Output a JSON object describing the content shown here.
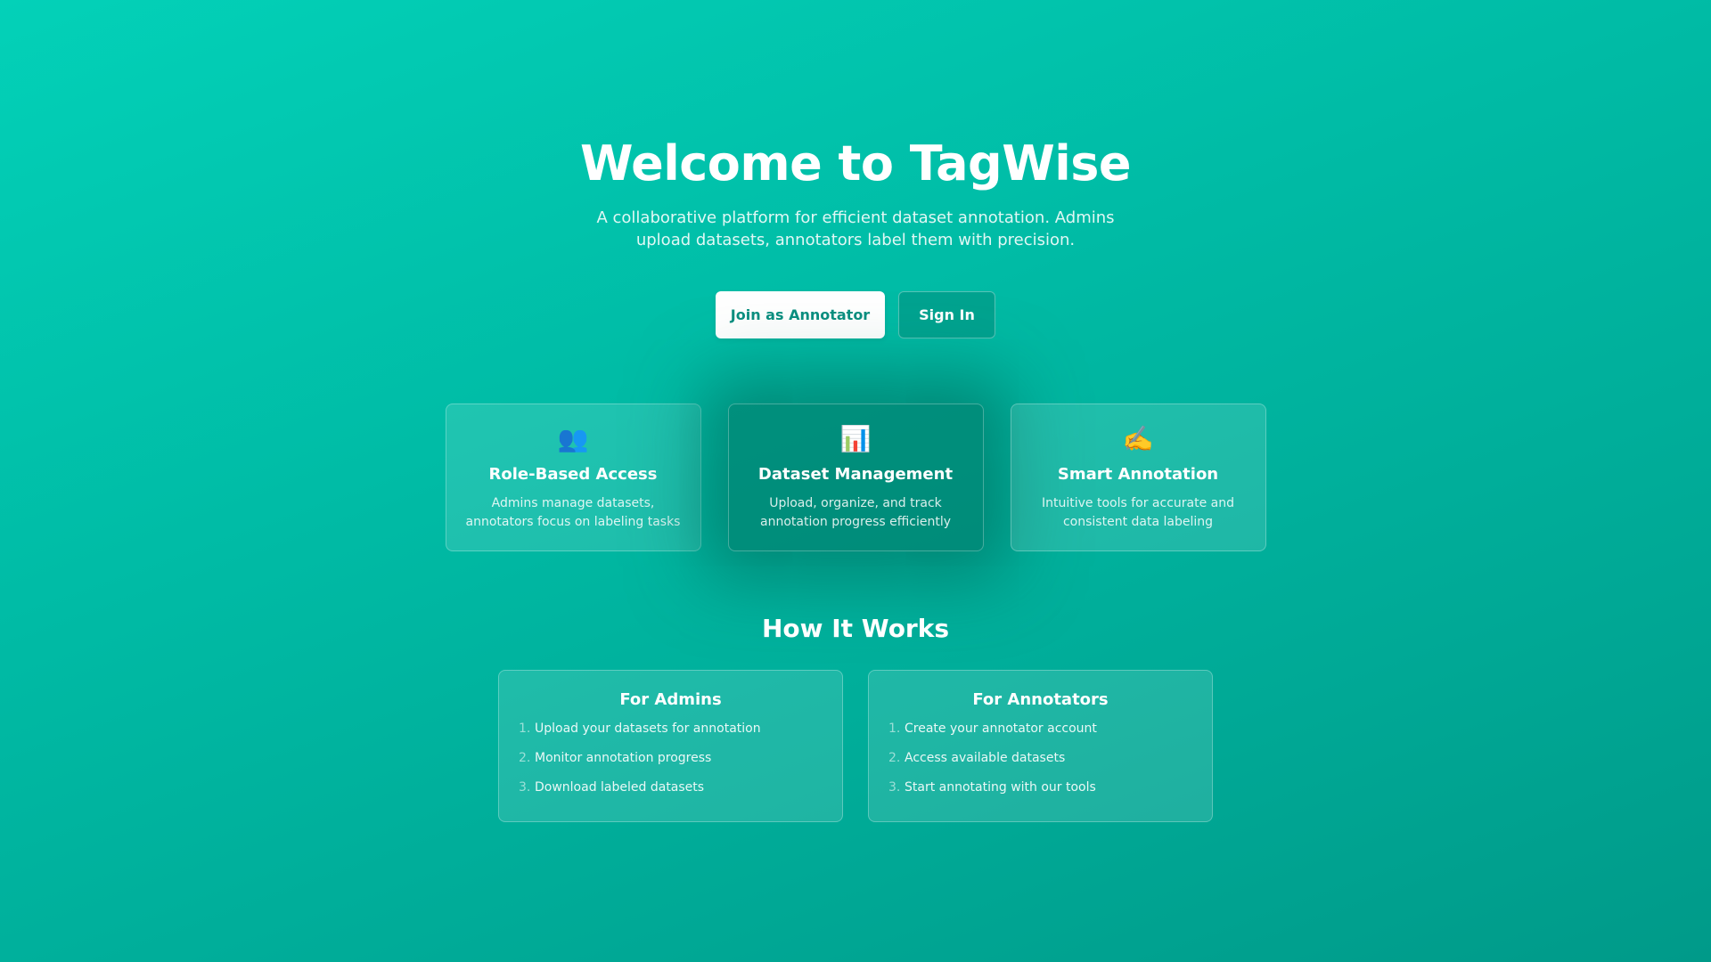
{
  "hero": {
    "title": "Welcome to TagWise",
    "subtitle": "A collaborative platform for efficient dataset annotation. Admins upload datasets, annotators label them with precision."
  },
  "cta": {
    "primary_label": "Join as Annotator",
    "secondary_label": "Sign In"
  },
  "features": [
    {
      "icon": "👥",
      "icon_name": "users-icon",
      "title": "Role-Based Access",
      "description": "Admins manage datasets, annotators focus on labeling tasks"
    },
    {
      "icon": "📊",
      "icon_name": "bar-chart-icon",
      "title": "Dataset Management",
      "description": "Upload, organize, and track annotation progress efficiently"
    },
    {
      "icon": "✍️",
      "icon_name": "writing-hand-icon",
      "title": "Smart Annotation",
      "description": "Intuitive tools for accurate and consistent data labeling"
    }
  ],
  "how_it_works": {
    "title": "How It Works",
    "admins": {
      "title": "For Admins",
      "steps": [
        {
          "num": "1.",
          "text": "Upload your datasets for annotation"
        },
        {
          "num": "2.",
          "text": "Monitor annotation progress"
        },
        {
          "num": "3.",
          "text": "Download labeled datasets"
        }
      ]
    },
    "annotators": {
      "title": "For Annotators",
      "steps": [
        {
          "num": "1.",
          "text": "Create your annotator account"
        },
        {
          "num": "2.",
          "text": "Access available datasets"
        },
        {
          "num": "3.",
          "text": "Start annotating with our tools"
        }
      ]
    }
  },
  "colors": {
    "gradient_start": "#03d1b8",
    "gradient_end": "#009a89",
    "primary_button_text": "#0b8f80"
  }
}
